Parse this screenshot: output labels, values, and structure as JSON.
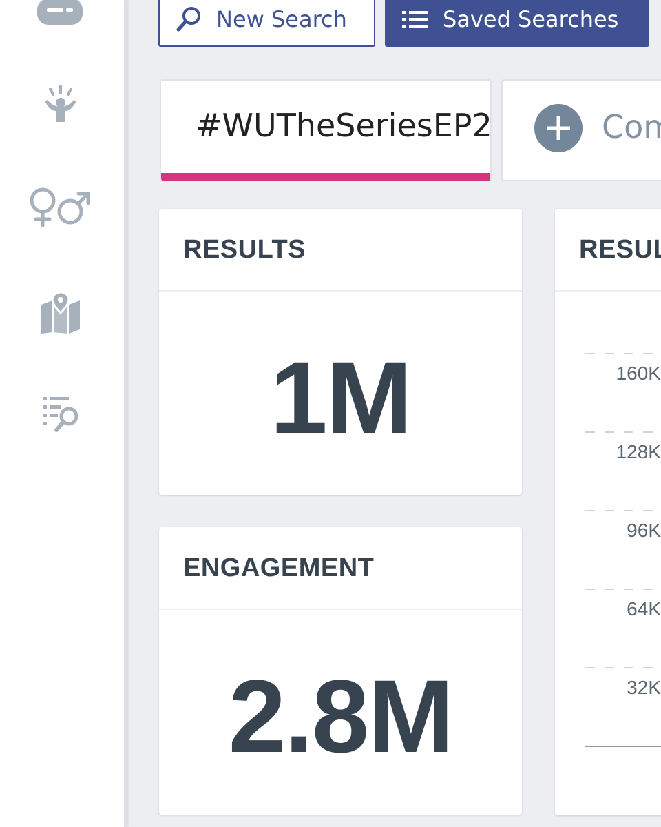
{
  "toolbar": {
    "new_search_label": "New Search",
    "saved_searches_label": "Saved Searches"
  },
  "sidebar": {
    "items": [
      {
        "icon": "bubble-icon"
      },
      {
        "icon": "sentiment-person-icon"
      },
      {
        "icon": "gender-icon"
      },
      {
        "icon": "map-pin-icon"
      },
      {
        "icon": "list-search-icon"
      }
    ]
  },
  "search_tabs": {
    "active_tab_label": "#WUTheSeriesEP2",
    "compare_tab_label": "Com"
  },
  "cards": {
    "results": {
      "title": "RESULTS",
      "value": "1M"
    },
    "engagement": {
      "title": "ENGAGEMENT",
      "value": "2.8M"
    },
    "results_chart": {
      "title": "RESUL"
    }
  },
  "colors": {
    "accent_blue": "#3f5192",
    "active_tab_underline": "#d6357e",
    "text_dark": "#37444f",
    "background": "#eceef1"
  },
  "chart_data": {
    "type": "line",
    "title": "RESUL",
    "y_ticks": [
      "160K",
      "128K",
      "96K",
      "64K",
      "32K"
    ],
    "ylim": [
      0,
      160000
    ],
    "grid": true
  }
}
